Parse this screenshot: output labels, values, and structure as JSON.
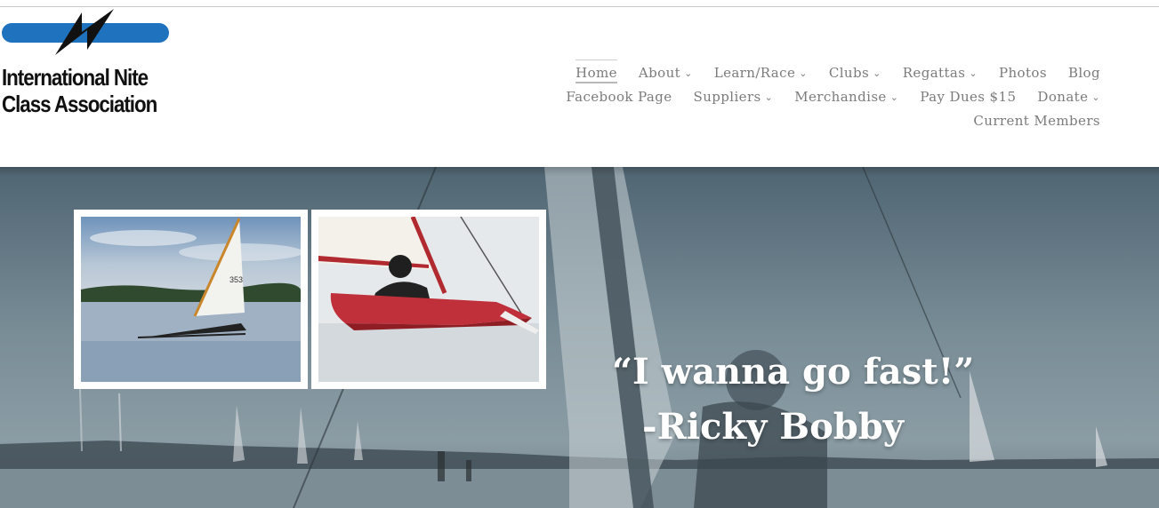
{
  "logo": {
    "line1": "International Nite",
    "line2": "Class Association"
  },
  "nav": {
    "row1": [
      {
        "label": "Home",
        "active": true,
        "dropdown": false
      },
      {
        "label": "About",
        "dropdown": true
      },
      {
        "label": "Learn/Race",
        "dropdown": true
      },
      {
        "label": "Clubs",
        "dropdown": true
      },
      {
        "label": "Regattas",
        "dropdown": true
      },
      {
        "label": "Photos",
        "dropdown": false
      },
      {
        "label": "Blog",
        "dropdown": false
      }
    ],
    "row2": [
      {
        "label": "Facebook Page",
        "dropdown": false
      },
      {
        "label": "Suppliers",
        "dropdown": true
      },
      {
        "label": "Merchandise",
        "dropdown": true
      },
      {
        "label": "Pay Dues $15",
        "dropdown": false
      },
      {
        "label": "Donate",
        "dropdown": true
      }
    ],
    "row3": [
      {
        "label": "Current Members",
        "dropdown": false
      }
    ],
    "caret": "⌄"
  },
  "hero": {
    "quote_line1": "“I wanna go fast!”",
    "quote_line2": "-Ricky Bobby"
  },
  "colors": {
    "logo_blue": "#1f73be",
    "nav_text": "#7b7b7b",
    "sail_red": "#c0303a"
  }
}
